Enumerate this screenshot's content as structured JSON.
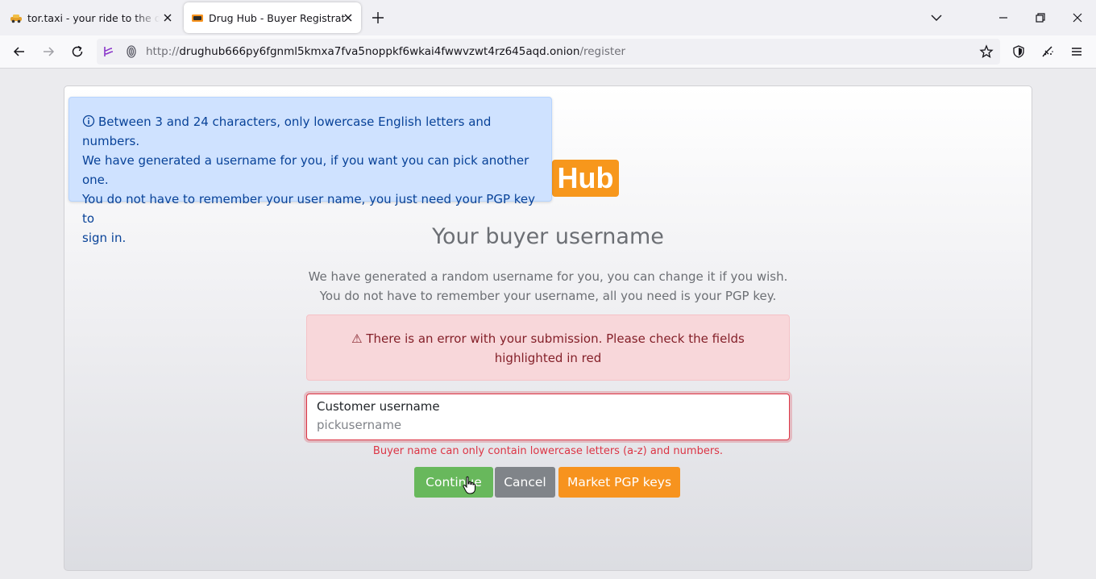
{
  "browser": {
    "tabs": [
      {
        "title": "tor.taxi - your ride to the darknet",
        "active": false
      },
      {
        "title": "Drug Hub - Buyer Registration",
        "active": true
      }
    ],
    "url": {
      "protocol": "http://",
      "host": "drughub666py6fgnml5kmxa7fva5noppkf6wkai4fwwvzwt4rz645aqd.onion",
      "path": "/register"
    }
  },
  "page": {
    "info_alert": {
      "lines": [
        "Between 3 and 24 characters, only lowercase English letters and numbers.",
        "We have generated a username for you, if you want you can pick another one.",
        "You do not have to remember your user name, you just need your PGP key to",
        "sign in."
      ]
    },
    "logo_text": "Hub",
    "heading": "Your buyer username",
    "intro": [
      "We have generated a random username for you, you can change it if you wish.",
      "You do not have to remember your username, all you need is your PGP key."
    ],
    "error_alert": "⚠ There is an error with your submission. Please check the fields highlighted in red",
    "username_field": {
      "label": "Customer username",
      "value": "",
      "placeholder": "pickusername"
    },
    "field_error": "Buyer name can only contain lowercase letters (a-z) and numbers.",
    "buttons": {
      "continue": "Continue",
      "cancel": "Cancel",
      "pgp": "Market PGP keys"
    }
  },
  "colors": {
    "info_bg": "#cfe2ff",
    "error_bg": "#f8d7da",
    "continue_green": "#68b85c",
    "cancel_gray": "#808489",
    "brand_orange": "#f7931e"
  }
}
